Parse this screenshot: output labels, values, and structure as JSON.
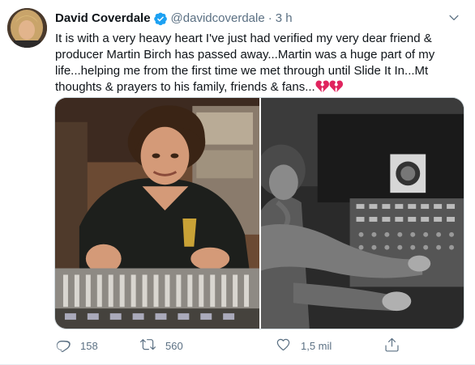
{
  "tweet": {
    "author_name": "David Coverdale",
    "handle": "@davidcoverdale",
    "separator": "·",
    "time": "3 h",
    "text": "It is with a very heavy heart I've just had verified my very dear friend & producer Martin Birch has passed away...Martin was a huge part of my life...helping me from the first time we met through until Slide It In...Mt thoughts & prayers to his family, friends & fans...",
    "emoji": "💔💔"
  },
  "actions": {
    "replies": "158",
    "retweets": "560",
    "likes": "1,5 mil"
  },
  "colors": {
    "verified": "#1da1f2",
    "secondary_text": "#5b7083",
    "broken_heart": "#e0245e"
  },
  "icons": {
    "verified": "verified-badge-icon",
    "more": "chevron-down-icon",
    "reply": "reply-icon",
    "retweet": "retweet-icon",
    "like": "heart-icon",
    "share": "share-icon"
  }
}
